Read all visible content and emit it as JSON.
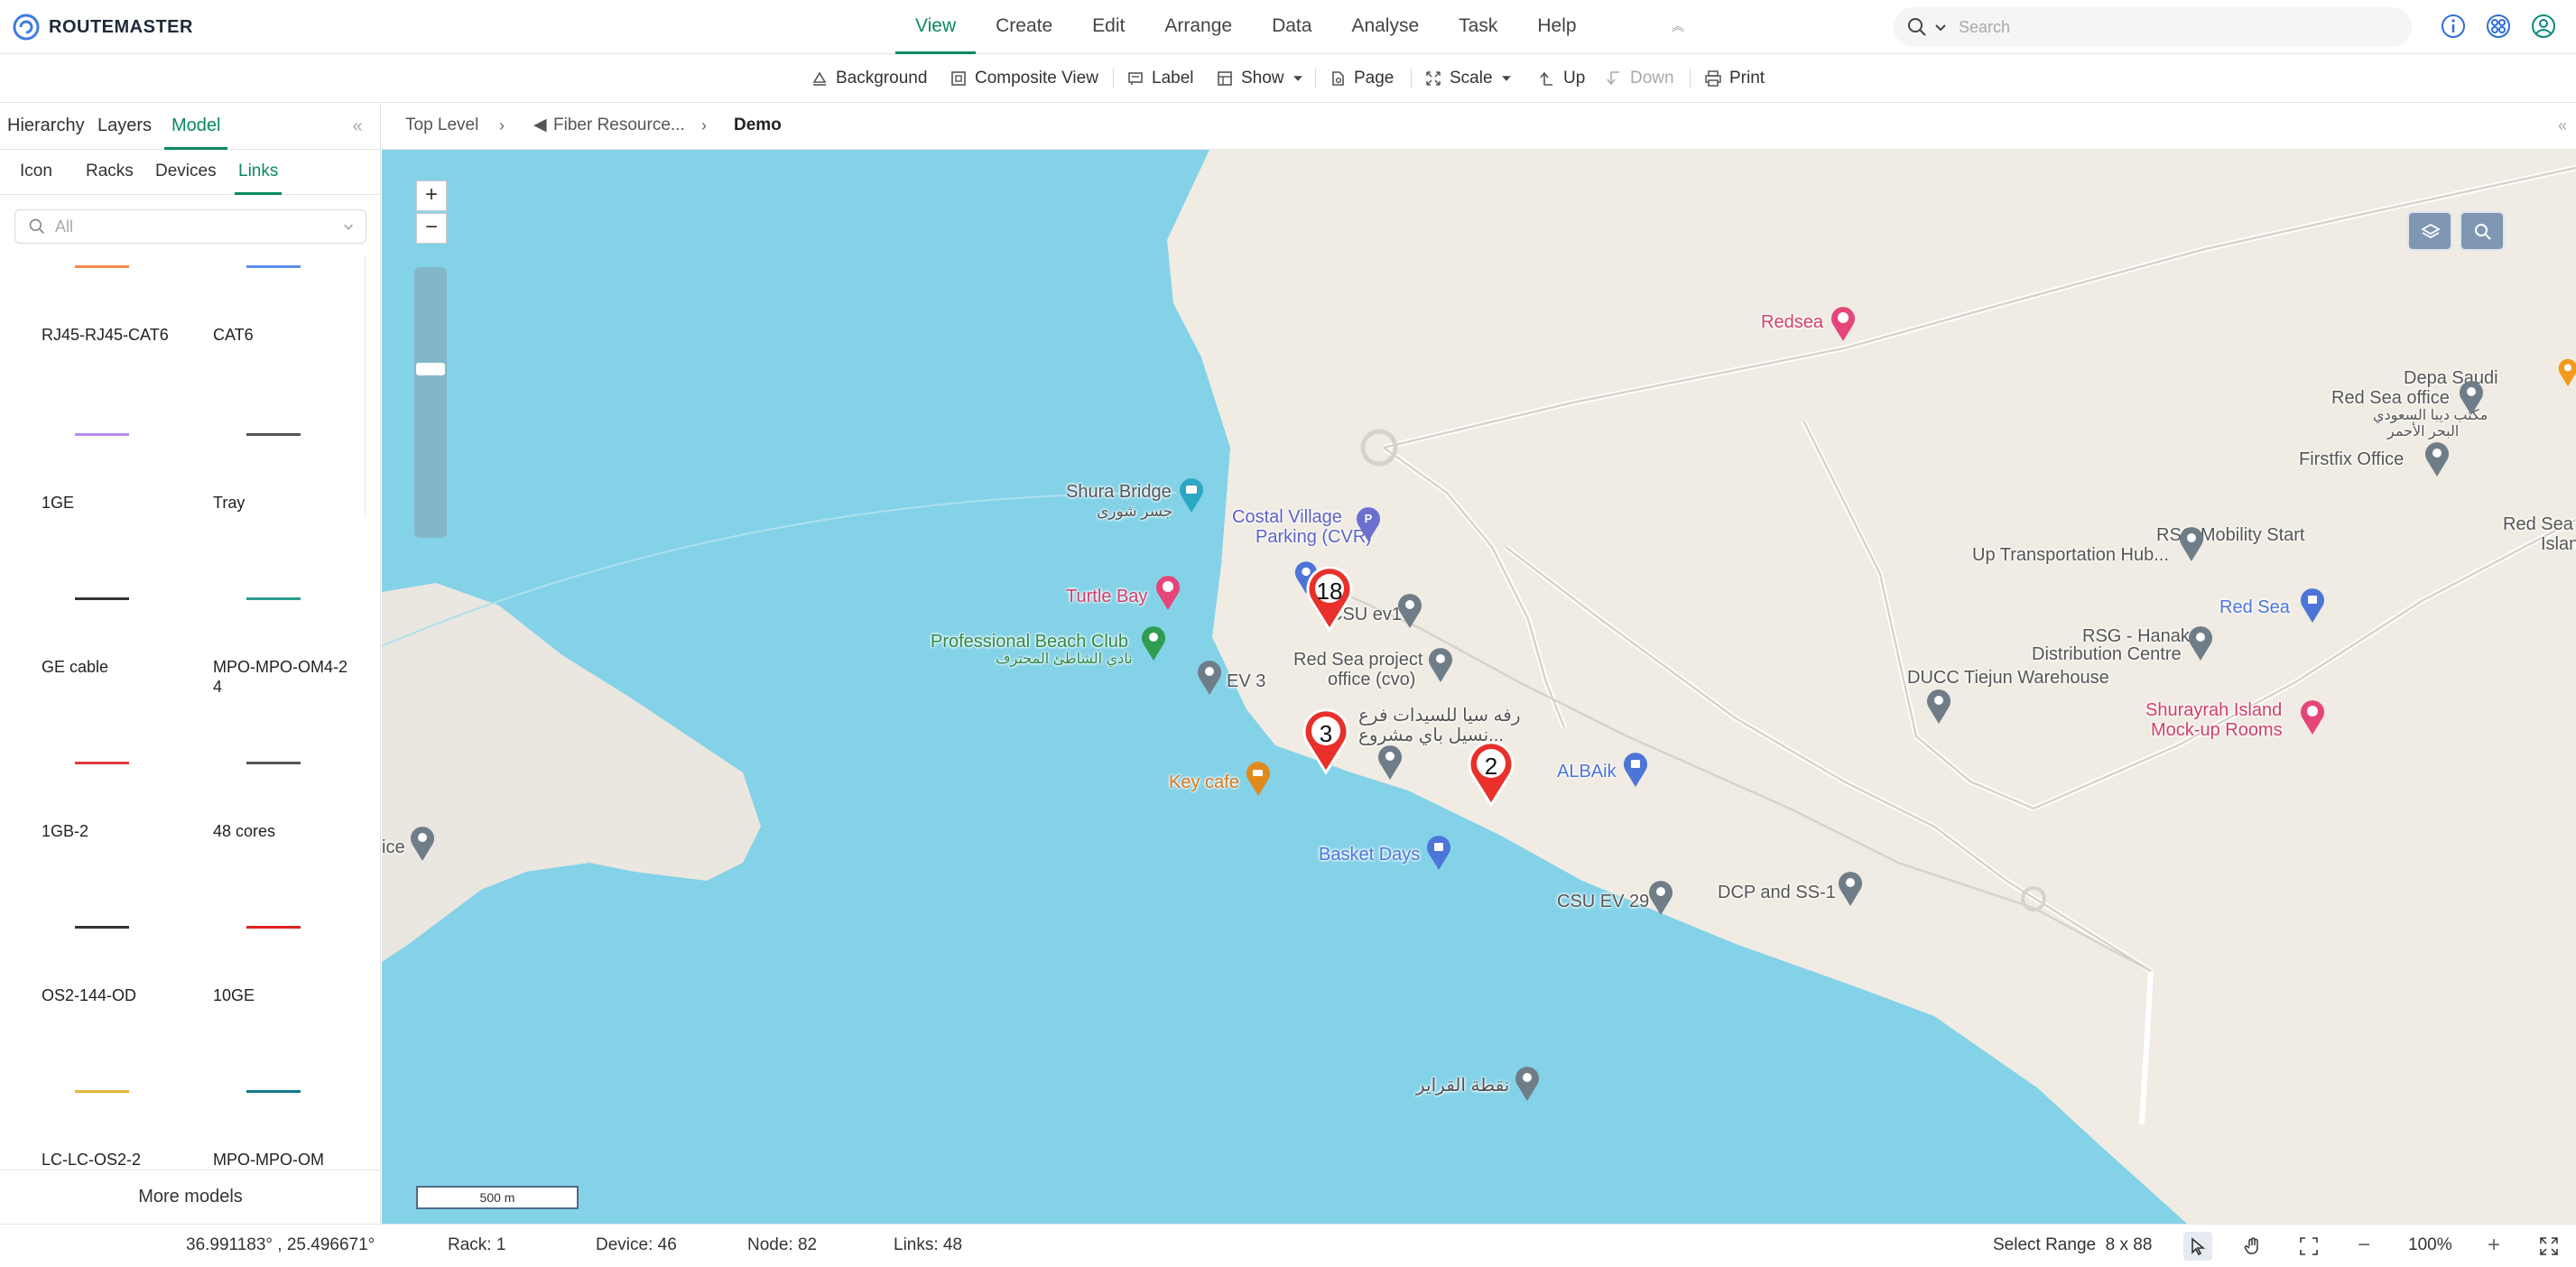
{
  "app": {
    "title": "ROUTEMASTER",
    "brand_color": "#0a8a5f"
  },
  "menu": {
    "items": [
      "View",
      "Create",
      "Edit",
      "Arrange",
      "Data",
      "Analyse",
      "Task",
      "Help"
    ],
    "active": "View"
  },
  "search": {
    "placeholder": "Search"
  },
  "top_icons": [
    "info-icon",
    "settings-icon",
    "user-icon"
  ],
  "toolbar": {
    "background": "Background",
    "composite_view": "Composite View",
    "label": "Label",
    "show": "Show",
    "page": "Page",
    "scale": "Scale",
    "up": "Up",
    "down": "Down",
    "print": "Print"
  },
  "panel": {
    "tabs": [
      "Hierarchy",
      "Layers",
      "Model"
    ],
    "active_tab": "Model",
    "model_tabs": [
      "Icon",
      "Racks",
      "Devices",
      "Links"
    ],
    "active_model_tab": "Links",
    "filter_placeholder": "All",
    "links": [
      {
        "label": "RJ45-RJ45-CAT6",
        "color": "#f08a4b"
      },
      {
        "label": "CAT6",
        "color": "#5b8def"
      },
      {
        "label": "1GE",
        "color": "#b58cf0"
      },
      {
        "label": "Tray",
        "color": "#555555"
      },
      {
        "label": "GE cable",
        "color": "#333333"
      },
      {
        "label": "MPO-MPO-OM4-24",
        "color": "#2a9d8f"
      },
      {
        "label": "1GB-2",
        "color": "#e23b3b"
      },
      {
        "label": "48 cores",
        "color": "#555555"
      },
      {
        "label": "OS2-144-OD",
        "color": "#333333"
      },
      {
        "label": "10GE",
        "color": "#e02020"
      },
      {
        "label": "LC-LC-OS2-2",
        "color": "#e5b53a"
      },
      {
        "label": "MPO-MPO-OM",
        "color": "#117a8b"
      }
    ],
    "more_models": "More models"
  },
  "breadcrumb": {
    "items": [
      "Top Level",
      "Fiber Resource...",
      "Demo"
    ]
  },
  "map": {
    "zoom_in": "+",
    "zoom_out": "−",
    "scale": "500 m",
    "water_color": "#84d2e8",
    "land_color": "#f0ece3",
    "places": [
      {
        "name": "Redsea",
        "cls": "pink"
      },
      {
        "name": "Depa Saudi",
        "cls": "grey"
      },
      {
        "name": "Red Sea office",
        "cls": "grey"
      },
      {
        "name": "مكتب ديبا السعودي",
        "cls": "grey"
      },
      {
        "name": "البحر الأحمر",
        "cls": "grey"
      },
      {
        "name": "Firstfix Office",
        "cls": "grey"
      },
      {
        "name": "Red Sea",
        "cls": "grey"
      },
      {
        "name": "Islan",
        "cls": "grey"
      },
      {
        "name": "Shura Bridge",
        "cls": "grey"
      },
      {
        "name": "جسر شورى",
        "cls": "grey"
      },
      {
        "name": "Costal Village",
        "cls": "violet"
      },
      {
        "name": "Parking (CVR)",
        "cls": "violet"
      },
      {
        "name": "RSG Mobility Start",
        "cls": "grey"
      },
      {
        "name": "Up Transportation Hub...",
        "cls": "grey"
      },
      {
        "name": "Turtle Bay",
        "cls": "pink"
      },
      {
        "name": "CSU ev1",
        "cls": "grey"
      },
      {
        "name": "Red Sea",
        "cls": "blue"
      },
      {
        "name": "Professional Beach Club",
        "cls": "green"
      },
      {
        "name": "نادي الشاطئ المحترف",
        "cls": "green"
      },
      {
        "name": "RSG - Hanak",
        "cls": "grey"
      },
      {
        "name": "Distribution Centre",
        "cls": "grey"
      },
      {
        "name": "EV 3",
        "cls": "grey"
      },
      {
        "name": "Red Sea project",
        "cls": "grey"
      },
      {
        "name": "office (cvo)",
        "cls": "grey"
      },
      {
        "name": "DUCC Tiejun Warehouse",
        "cls": "grey"
      },
      {
        "name": "رفه سيا للسيدات فرع",
        "cls": "grey"
      },
      {
        "name": "نسيل باي مشروع...",
        "cls": "grey"
      },
      {
        "name": "Shurayrah Island",
        "cls": "pink"
      },
      {
        "name": "Mock-up Rooms",
        "cls": "pink"
      },
      {
        "name": "ALBAik",
        "cls": "blue"
      },
      {
        "name": "Key cafe",
        "cls": "orange"
      },
      {
        "name": "ice",
        "cls": "grey"
      },
      {
        "name": "Basket Days",
        "cls": "blue"
      },
      {
        "name": "CSU EV 29",
        "cls": "grey"
      },
      {
        "name": "DCP and SS-1",
        "cls": "grey"
      },
      {
        "name": "نقطة القراير",
        "cls": "grey"
      }
    ],
    "markers": [
      "18",
      "3",
      "2"
    ]
  },
  "status": {
    "coords": "36.991183° , 25.496671°",
    "rack": "Rack: 1",
    "device": "Device: 46",
    "node": "Node: 82",
    "links": "Links: 48",
    "select_range": "Select Range  8 x 88",
    "zoom": "100%",
    "zoom_out": "−",
    "zoom_in": "+"
  }
}
